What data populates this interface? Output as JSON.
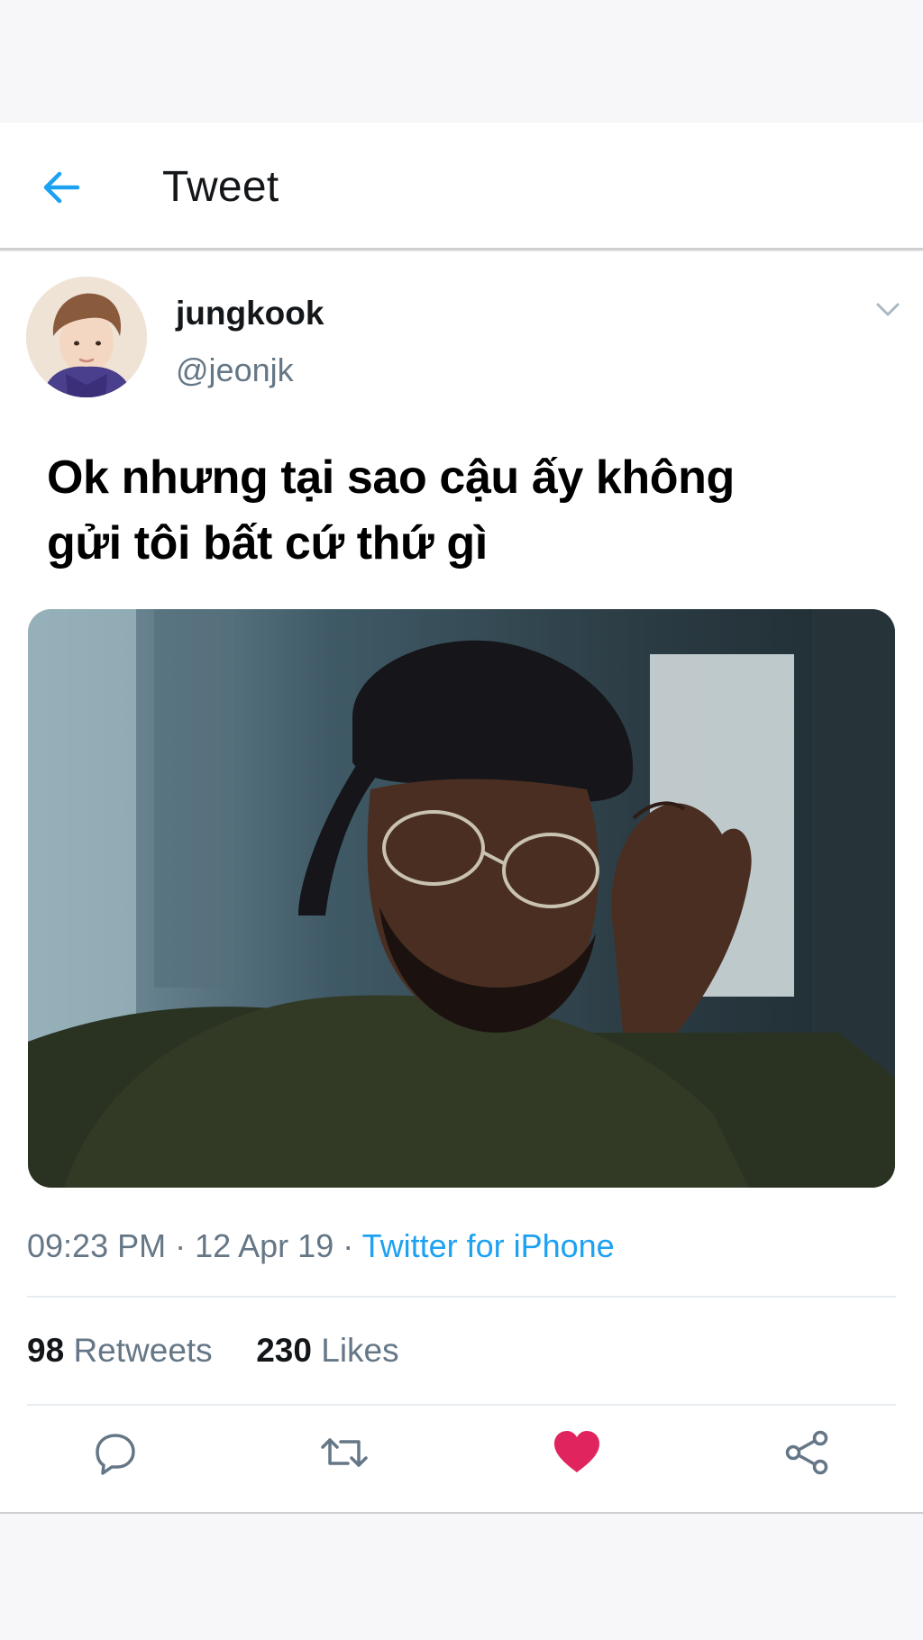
{
  "header": {
    "title": "Tweet",
    "back_icon": "arrow-left-icon",
    "accent_color": "#1da1f2"
  },
  "tweet": {
    "author": {
      "display_name": "jungkook",
      "handle": "@jeonjk",
      "avatar_icon": "user-avatar"
    },
    "menu_icon": "chevron-down-icon",
    "text_lines": [
      "Ok nhưng tại sao cậu ấy không",
      "gửi tôi bất cứ thứ gì"
    ],
    "media_icon": "photo",
    "time": "09:23 PM",
    "date": "12 Apr 19",
    "separator": " · ",
    "source": "Twitter for iPhone",
    "retweets": {
      "count": "98",
      "label": "Retweets"
    },
    "likes": {
      "count": "230",
      "label": "Likes"
    }
  },
  "actions": {
    "reply_icon": "reply-icon",
    "retweet_icon": "retweet-icon",
    "like_icon": "heart-icon",
    "share_icon": "share-icon",
    "liked_color": "#e0245e",
    "icon_color": "#657786"
  }
}
